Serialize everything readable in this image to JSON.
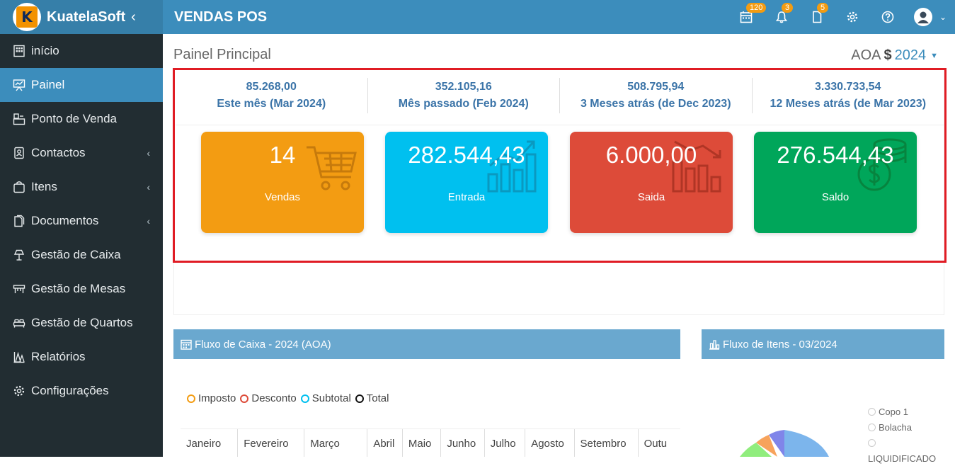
{
  "brand": {
    "name": "KuatelaSoft",
    "logo_letter": "K"
  },
  "header": {
    "app_title": "VENDAS POS",
    "badges": {
      "calendar": "120",
      "notifications": "3",
      "documents": "5"
    }
  },
  "sidebar": {
    "items": [
      {
        "label": "início"
      },
      {
        "label": "Painel"
      },
      {
        "label": "Ponto de Venda"
      },
      {
        "label": "Contactos"
      },
      {
        "label": "Itens"
      },
      {
        "label": "Documentos"
      },
      {
        "label": "Gestão de Caixa"
      },
      {
        "label": "Gestão de Mesas"
      },
      {
        "label": "Gestão de Quartos"
      },
      {
        "label": "Relatórios"
      },
      {
        "label": "Configurações"
      }
    ]
  },
  "main": {
    "title": "Painel Principal",
    "currency": "AOA",
    "currency_symbol": "$",
    "year": "2024",
    "stats": [
      {
        "value": "85.268,00",
        "label": "Este mês (Mar 2024)"
      },
      {
        "value": "352.105,16",
        "label": "Mês passado (Feb 2024)"
      },
      {
        "value": "508.795,94",
        "label": "3 Meses atrás (de Dec 2023)"
      },
      {
        "value": "3.330.733,54",
        "label": "12 Meses atrás (de Mar 2023)"
      }
    ],
    "boxes": [
      {
        "value": "14",
        "label": "Vendas",
        "color": "#f39c12"
      },
      {
        "value": "282.544,43",
        "label": "Entrada",
        "color": "#00c0ef"
      },
      {
        "value": "6.000,00",
        "label": "Saida",
        "color": "#dd4b39"
      },
      {
        "value": "276.544,43",
        "label": "Saldo",
        "color": "#00a65a"
      }
    ]
  },
  "cash_flow": {
    "title": "Fluxo de Caixa - 2024 (AOA)",
    "legend": [
      {
        "label": "Imposto",
        "color": "#f39c12"
      },
      {
        "label": "Desconto",
        "color": "#dd4b39"
      },
      {
        "label": "Subtotal",
        "color": "#00c0ef"
      },
      {
        "label": "Total",
        "color": "#111111"
      }
    ],
    "months": [
      "Janeiro",
      "Fevereiro",
      "Março",
      "Abril",
      "Maio",
      "Junho",
      "Julho",
      "Agosto",
      "Setembro",
      "Outu"
    ]
  },
  "items_flow": {
    "title": "Fluxo de Itens - 03/2024",
    "legend": [
      "Copo 1",
      "Bolacha",
      "LIQUIDIFICADO"
    ]
  }
}
